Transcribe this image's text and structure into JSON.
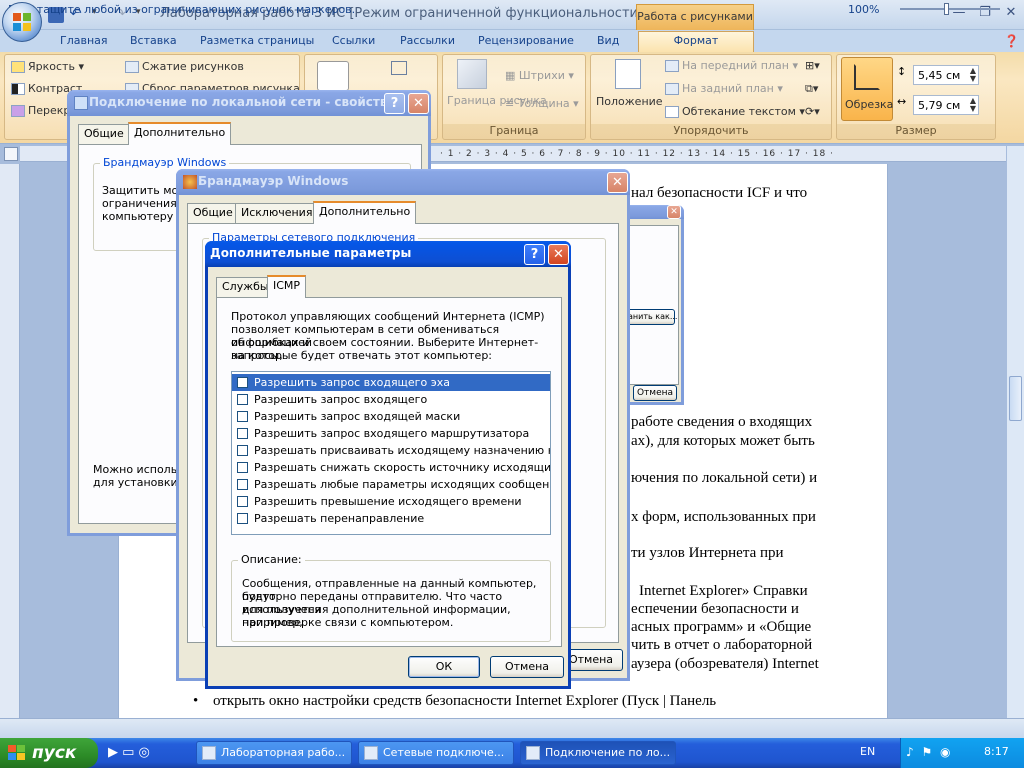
{
  "app": {
    "title": "Лабораторная работа 3 ИС [Режим ограниченной функциональности] - M...",
    "context_tab": "Работа с рисунками"
  },
  "ribbon_tabs": [
    "Главная",
    "Вставка",
    "Разметка страницы",
    "Ссылки",
    "Рассылки",
    "Рецензирование",
    "Вид",
    "Формат"
  ],
  "ribbon": {
    "brightness": "Яркость",
    "contrast": "Контраст",
    "recolor": "Перекр...",
    "compress": "Сжатие рисунков",
    "reset": "Сброс параметров рисунка",
    "border": "Граница рисунка",
    "strokes": "Штрихи",
    "thickness": "Толщина",
    "group_border": "Граница",
    "position": "Положение",
    "front": "На передний план",
    "back": "На задний план",
    "wrap": "Обтекание текстом",
    "group_arrange": "Упорядочить",
    "crop": "Обрезка",
    "height": "5,45 см",
    "width": "5,79 см",
    "group_size": "Размер"
  },
  "document": {
    "line1": "нал  безопасности  ICF  и  что",
    "line2": "работе сведения о входящих",
    "line3": "ах), для которых может быть",
    "line4": "ючения по локальной сети) и",
    "line5": "х форм, использованных при",
    "line6": "ти     узлов     Интернета     при",
    "line7": "Internet  Explorer»  Справки",
    "line8": "еспечении   безопасности   и",
    "line9": "асных программ» и «Общие",
    "line10": "чить в отчет о лабораторной",
    "line11": "аузера  (обозревателя)  Internet",
    "bullet_line": "открыть   окно   настройки   средств   безопасности   Internet   Explorer   (Пуск  |  Панель",
    "ruler": "· 1 · 2 · 3 · 4 · 5 · 6 · 7 · 8 · 9 · 10 · 11 · 12 · 13 · 14 · 15 · 16 · 17 · 18 ·"
  },
  "status": {
    "text": "Перетащите любой из ограничивающих рисунок маркеров.",
    "zoom": "100%"
  },
  "win_lan": {
    "title": "Подключение по локальной сети - свойства",
    "tabs": [
      "Общие",
      "Дополнительно"
    ],
    "group": "Брандмауэр Windows",
    "text1": "Защитить мой",
    "text2": "ограничения и",
    "text3": "компьютеру че",
    "text4": "Можно использо",
    "text5": "для установки эт"
  },
  "win_fw": {
    "title": "Брандмауэр Windows",
    "tabs": [
      "Общие",
      "Исключения",
      "Дополнительно"
    ],
    "group": "Параметры сетевого подключения",
    "cancel": "Отмена"
  },
  "win_bg": {
    "save_as": "анить как...",
    "cancel": "Отмена"
  },
  "dialog": {
    "title": "Дополнительные параметры",
    "tabs": [
      "Службы",
      "ICMP"
    ],
    "intro": [
      "Протокол управляющих сообщений Интернета (ICMP)",
      "позволяет компьютерам в сети обмениваться информацией",
      "об ошибках и своем состоянии. Выберите Интернет-запросы,",
      "на которые будет отвечать этот компьютер:"
    ],
    "items": [
      "Разрешить запрос входящего эха",
      "Разрешить запрос входящего",
      "Разрешить запрос входящей маски",
      "Разрешить запрос входящего маршрутизатора",
      "Разрешать присваивать исходящему назначению недос...",
      "Разрешать снижать скорость источнику исходящих соо...",
      "Разрешать любые параметры исходящих сообщений",
      "Разрешить превышение исходящего времени",
      "Разрешать перенаправление"
    ],
    "desc_label": "Описание:",
    "desc": [
      "Сообщения, отправленные на данный компьютер, будут",
      "повторно переданы отправителю. Что часто используется",
      "для получения дополнительной информации, например,",
      "при проверке связи с компьютером."
    ],
    "ok": "ОК",
    "cancel": "Отмена"
  },
  "taskbar": {
    "start": "пуск",
    "items": [
      "Лабораторная рабо...",
      "Сетевые подключе...",
      "Подключение по ло..."
    ],
    "lang": "EN",
    "time": "8:17"
  }
}
